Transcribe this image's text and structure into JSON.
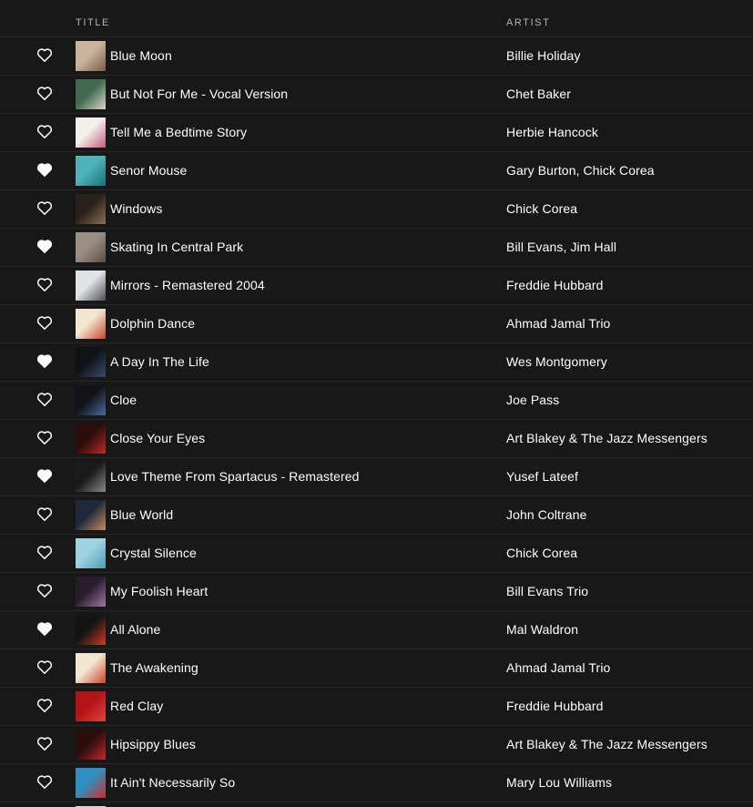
{
  "header": {
    "title_label": "TITLE",
    "artist_label": "ARTIST"
  },
  "colors": {
    "background": "#181818",
    "divider": "#282828",
    "text": "#ffffff",
    "muted": "#b3b3b3"
  },
  "tracks": [
    {
      "title": "Blue Moon",
      "artist": "Billie Holiday",
      "liked": false,
      "cover_colors": [
        "#c9b49a",
        "#7a5d4a"
      ]
    },
    {
      "title": "But Not For Me - Vocal Version",
      "artist": "Chet Baker",
      "liked": false,
      "cover_colors": [
        "#3f6a4d",
        "#d8d4c6"
      ]
    },
    {
      "title": "Tell Me a Bedtime Story",
      "artist": "Herbie Hancock",
      "liked": false,
      "cover_colors": [
        "#f4f1ea",
        "#c25a86"
      ]
    },
    {
      "title": "Senor Mouse",
      "artist": "Gary Burton, Chick Corea",
      "liked": true,
      "cover_colors": [
        "#4db3b8",
        "#1d6f7a"
      ]
    },
    {
      "title": "Windows",
      "artist": "Chick Corea",
      "liked": false,
      "cover_colors": [
        "#2a211c",
        "#8c6f52"
      ]
    },
    {
      "title": "Skating In Central Park",
      "artist": "Bill Evans, Jim Hall",
      "liked": true,
      "cover_colors": [
        "#9a8d82",
        "#5b4d45"
      ]
    },
    {
      "title": "Mirrors - Remastered 2004",
      "artist": "Freddie Hubbard",
      "liked": false,
      "cover_colors": [
        "#dfe3e6",
        "#4b4f57"
      ]
    },
    {
      "title": "Dolphin Dance",
      "artist": "Ahmad Jamal Trio",
      "liked": false,
      "cover_colors": [
        "#f2e6d0",
        "#c8432a"
      ]
    },
    {
      "title": "A Day In The Life",
      "artist": "Wes Montgomery",
      "liked": true,
      "cover_colors": [
        "#101216",
        "#3a4d6c"
      ]
    },
    {
      "title": "Cloe",
      "artist": "Joe Pass",
      "liked": false,
      "cover_colors": [
        "#111319",
        "#4d6a9c"
      ]
    },
    {
      "title": "Close Your Eyes",
      "artist": "Art Blakey & The Jazz Messengers",
      "liked": false,
      "cover_colors": [
        "#2a0e0c",
        "#c2272d"
      ]
    },
    {
      "title": "Love Theme From Spartacus - Remastered",
      "artist": "Yusef Lateef",
      "liked": true,
      "cover_colors": [
        "#1b1b1b",
        "#8a8a8a"
      ]
    },
    {
      "title": "Blue World",
      "artist": "John Coltrane",
      "liked": false,
      "cover_colors": [
        "#1e2a3a",
        "#c98a5e"
      ]
    },
    {
      "title": "Crystal Silence",
      "artist": "Chick Corea",
      "liked": false,
      "cover_colors": [
        "#9ed3e0",
        "#4a9bb4"
      ]
    },
    {
      "title": "My Foolish Heart",
      "artist": "Bill Evans Trio",
      "liked": false,
      "cover_colors": [
        "#2a1d2b",
        "#9b7ba6"
      ]
    },
    {
      "title": "All Alone",
      "artist": "Mal Waldron",
      "liked": true,
      "cover_colors": [
        "#141414",
        "#d23a22"
      ]
    },
    {
      "title": "The Awakening",
      "artist": "Ahmad Jamal Trio",
      "liked": false,
      "cover_colors": [
        "#f2e6d0",
        "#c8432a"
      ]
    },
    {
      "title": "Red Clay",
      "artist": "Freddie Hubbard",
      "liked": false,
      "cover_colors": [
        "#b3141a",
        "#e2453d"
      ]
    },
    {
      "title": "Hipsippy Blues",
      "artist": "Art Blakey & The Jazz Messengers",
      "liked": false,
      "cover_colors": [
        "#2a0e0c",
        "#c2272d"
      ]
    },
    {
      "title": "It Ain't Necessarily So",
      "artist": "Mary Lou Williams",
      "liked": false,
      "cover_colors": [
        "#2f8fc0",
        "#d22b2b"
      ]
    }
  ]
}
